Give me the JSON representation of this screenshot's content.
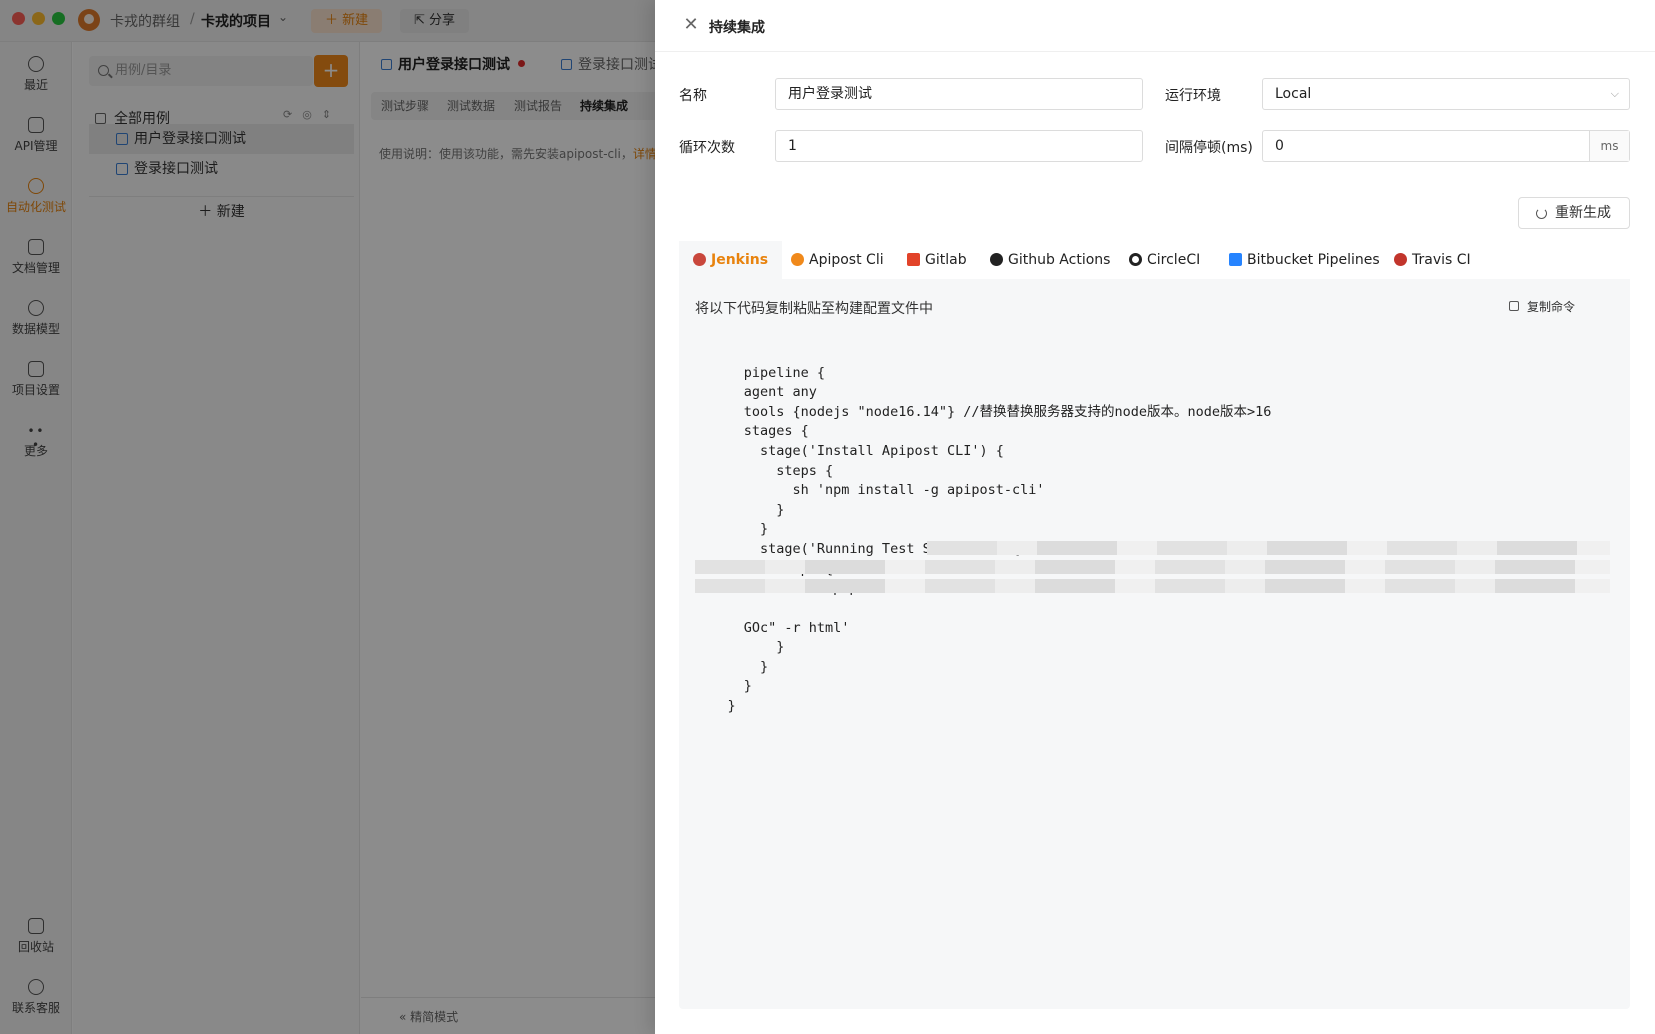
{
  "titlebar": {
    "group": "卡戎的群组",
    "separator": "/",
    "project": "卡戎的项目",
    "new_label": "＋ 新建",
    "share_label": "分享"
  },
  "leftnav": {
    "items": [
      {
        "label": "最近",
        "icon": "history-icon"
      },
      {
        "label": "API管理",
        "icon": "api-icon"
      },
      {
        "label": "自动化测试",
        "icon": "automation-icon",
        "active": true
      },
      {
        "label": "文档管理",
        "icon": "document-icon"
      },
      {
        "label": "数据模型",
        "icon": "data-model-icon"
      },
      {
        "label": "项目设置",
        "icon": "settings-icon"
      },
      {
        "label": "更多",
        "icon": "more-icon"
      }
    ],
    "bottom": [
      {
        "label": "回收站",
        "icon": "trash-icon"
      },
      {
        "label": "联系客服",
        "icon": "headset-icon"
      }
    ]
  },
  "tree": {
    "search_placeholder": "用例/目录",
    "add_label": "+",
    "root_label": "全部用例",
    "items": [
      "用户登录接口测试",
      "登录接口测试"
    ],
    "new_label": "＋ 新建"
  },
  "main": {
    "tabs": [
      "用户登录接口测试",
      "登录接口测试"
    ],
    "subtabs": [
      "测试步骤",
      "测试数据",
      "测试报告",
      "持续集成"
    ],
    "hint": "使用说明：使用该功能，需先安装apipost-cli，",
    "hint_more": "详情",
    "footer_mode": "«  精简模式"
  },
  "drawer": {
    "title": "持续集成",
    "close_icon": "close-icon",
    "name_label": "名称",
    "name_value": "用户登录测试",
    "env_label": "运行环境",
    "env_value": "Local",
    "loop_label": "循环次数",
    "loop_value": "1",
    "interval_label": "间隔停顿(ms)",
    "interval_value": "0",
    "interval_unit": "ms",
    "regen_label": "重新生成",
    "ci_tabs": [
      {
        "label": "Jenkins",
        "icon": "jenkins-icon",
        "color": "#c9473c"
      },
      {
        "label": "Apipost Cli",
        "icon": "apipost-icon",
        "color": "#f0891b"
      },
      {
        "label": "Gitlab",
        "icon": "gitlab-icon",
        "color": "#e24329"
      },
      {
        "label": "Github Actions",
        "icon": "github-icon",
        "color": "#222222"
      },
      {
        "label": "CircleCI",
        "icon": "circleci-icon",
        "color": "#222222"
      },
      {
        "label": "Bitbucket Pipelines",
        "icon": "bitbucket-icon",
        "color": "#2684ff"
      },
      {
        "label": "Travis CI",
        "icon": "travis-icon",
        "color": "#c2352c"
      }
    ],
    "active_ci": "Jenkins",
    "code_caption": "将以下代码复制粘贴至构建配置文件中",
    "copy_label": "复制命令",
    "code_before_redaction": "pipeline {\n      agent any\n      tools {nodejs \"node16.14\"} //替换替换服务器支持的node版本。node版本>16\n      stages {\n        stage('Install Apipost CLI') {\n          steps {\n            sh 'npm install -g apipost-cli'\n          }\n        }\n        stage('Running Test Scenario') {\n          steps {\n            sh 'apipost run \"",
    "code_after_redaction": "GOc\" -r html'\n          }\n        }\n      }\n    }"
  },
  "colors": {
    "accent": "#e8830e",
    "accent_button": "#f0891b",
    "tab_dot": "#e02b2b",
    "link_blue": "#3b7fd4"
  }
}
